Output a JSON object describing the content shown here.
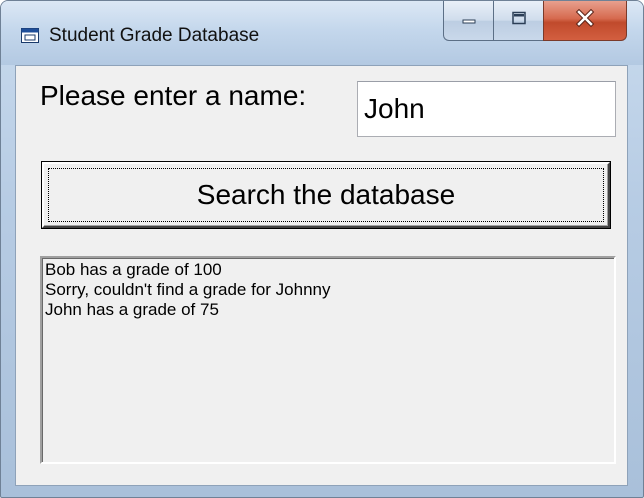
{
  "window": {
    "title": "Student Grade Database",
    "title_icon": "app-window-icon",
    "caption_buttons": [
      "minimize-icon",
      "maximize-icon",
      "close-icon"
    ]
  },
  "form": {
    "prompt_label": "Please enter a name:",
    "name_value": "John",
    "search_button_label": "Search the database"
  },
  "results": {
    "lines": [
      "Bob has a grade of 100",
      "Sorry, couldn't find a grade for Johnny",
      "John has a grade of 75"
    ]
  },
  "colors": {
    "close_button": "#c04a2c",
    "frame": "#b7cce4",
    "client_background": "#f0f0f0"
  }
}
